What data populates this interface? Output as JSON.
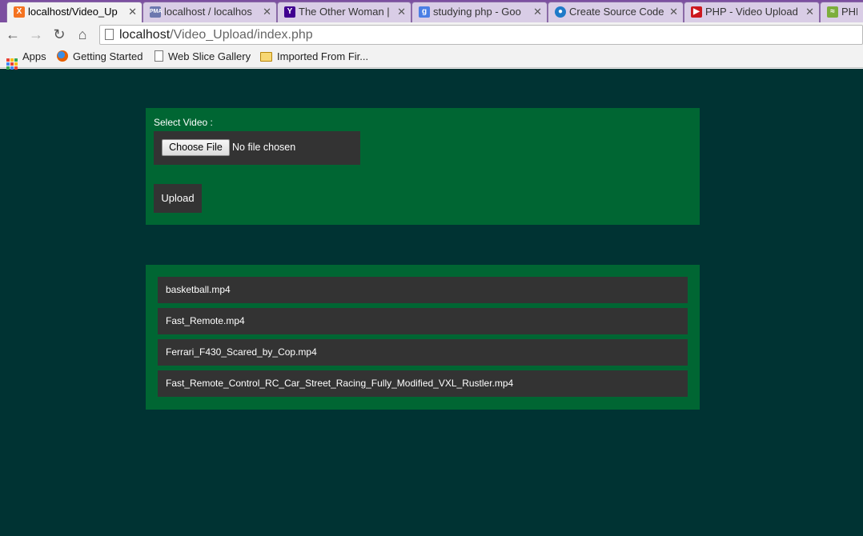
{
  "tabs": [
    {
      "label": "localhost/Video_Up",
      "icon": "xampp-icon",
      "color": "#f47321",
      "active": true
    },
    {
      "label": "localhost / localhos",
      "icon": "phpmyadmin-icon",
      "color": "#6c78af",
      "active": false
    },
    {
      "label": "The Other Woman |",
      "icon": "yahoo-icon",
      "color": "#400090",
      "active": false
    },
    {
      "label": "studying php - Goo",
      "icon": "google-icon",
      "color": "#4a7fe5",
      "active": false
    },
    {
      "label": "Create Source Code",
      "icon": "drupal-icon",
      "color": "#1f7ac8",
      "active": false
    },
    {
      "label": "PHP - Video Upload",
      "icon": "youtube-icon",
      "color": "#cc181e",
      "active": false
    },
    {
      "label": "PHP",
      "icon": "site-icon",
      "color": "#7cae3b",
      "active": false
    }
  ],
  "address": {
    "host": "localhost",
    "path": "/Video_Upload/index.php"
  },
  "bookmarks": [
    {
      "label": "Apps",
      "icon": "apps-grid-icon"
    },
    {
      "label": "Getting Started",
      "icon": "firefox-icon"
    },
    {
      "label": "Web Slice Gallery",
      "icon": "page-icon"
    },
    {
      "label": "Imported From Fir...",
      "icon": "folder-icon"
    }
  ],
  "form": {
    "select_label": "Select Video :",
    "choose_button": "Choose File",
    "file_status": "No file chosen",
    "upload_button": "Upload"
  },
  "videos": [
    "basketball.mp4",
    "Fast_Remote.mp4",
    "Ferrari_F430_Scared_by_Cop.mp4",
    "Fast_Remote_Control_RC_Car_Street_Racing_Fully_Modified_VXL_Rustler.mp4"
  ],
  "colors": {
    "page_bg": "#003333",
    "panel_bg": "#006633",
    "item_bg": "#333333"
  }
}
